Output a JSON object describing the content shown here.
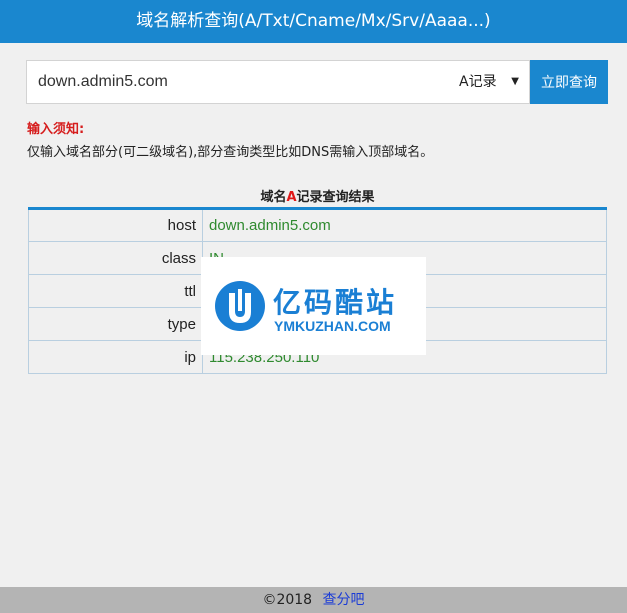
{
  "header": {
    "title": "域名解析查询(A/Txt/Cname/Mx/Srv/Aaaa...)"
  },
  "search": {
    "domain_value": "down.admin5.com",
    "record_type": "A记录",
    "submit_label": "立即查询"
  },
  "notice": {
    "title": "输入须知:",
    "text": "仅输入域名部分(可二级域名),部分查询类型比如DNS需输入顶部域名。"
  },
  "results": {
    "title_prefix": "域名",
    "title_highlight": "A",
    "title_suffix": "记录查询结果",
    "rows": [
      {
        "key": "host",
        "value": "down.admin5.com"
      },
      {
        "key": "class",
        "value": "IN"
      },
      {
        "key": "ttl",
        "value": ""
      },
      {
        "key": "type",
        "value": ""
      },
      {
        "key": "ip",
        "value": "115.238.250.110"
      }
    ]
  },
  "watermark": {
    "name_cn": "亿码酷站",
    "name_en": "YMKUZHAN.COM"
  },
  "footer": {
    "copyright": "©2018",
    "link_label": "查分吧"
  },
  "colors": {
    "accent": "#1a87cf",
    "value_green": "#2f8a2f",
    "notice_red": "#d61d1d"
  }
}
